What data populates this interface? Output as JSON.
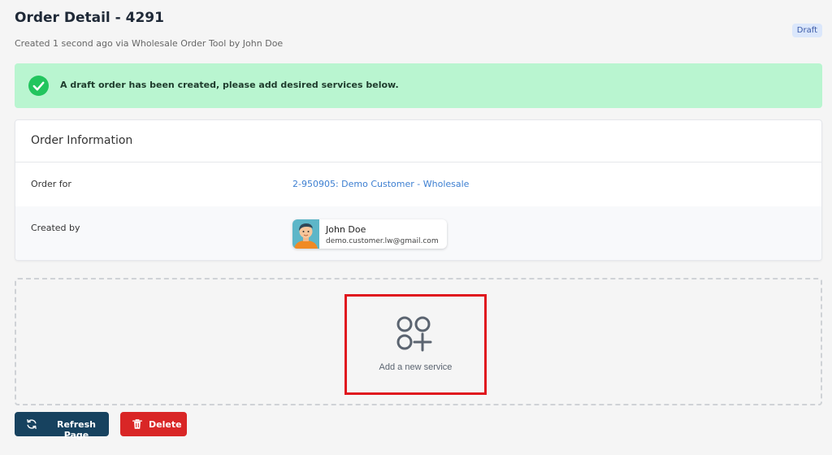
{
  "header": {
    "title": "Order Detail - 4291",
    "subtitle": "Created 1 second ago via Wholesale Order Tool by John Doe",
    "status_badge": "Draft"
  },
  "alert": {
    "icon": "check-circle-icon",
    "message": "A draft order has been created, please add desired services below.",
    "color": "#b9f5d0"
  },
  "order_info": {
    "title": "Order Information",
    "order_for_label": "Order for",
    "order_for_value": "2-950905: Demo Customer - Wholesale",
    "created_by_label": "Created by",
    "created_by": {
      "name": "John Doe",
      "email": "demo.customer.lw@gmail.com"
    }
  },
  "services": {
    "icon": "add-service-icon",
    "add_label": "Add a new service"
  },
  "actions": {
    "refresh_label": "Refresh Page",
    "delete_label": "Delete"
  },
  "colors": {
    "primary": "#17425f",
    "danger": "#d92626",
    "link": "#3d7fd1",
    "highlight": "#e0161e"
  }
}
